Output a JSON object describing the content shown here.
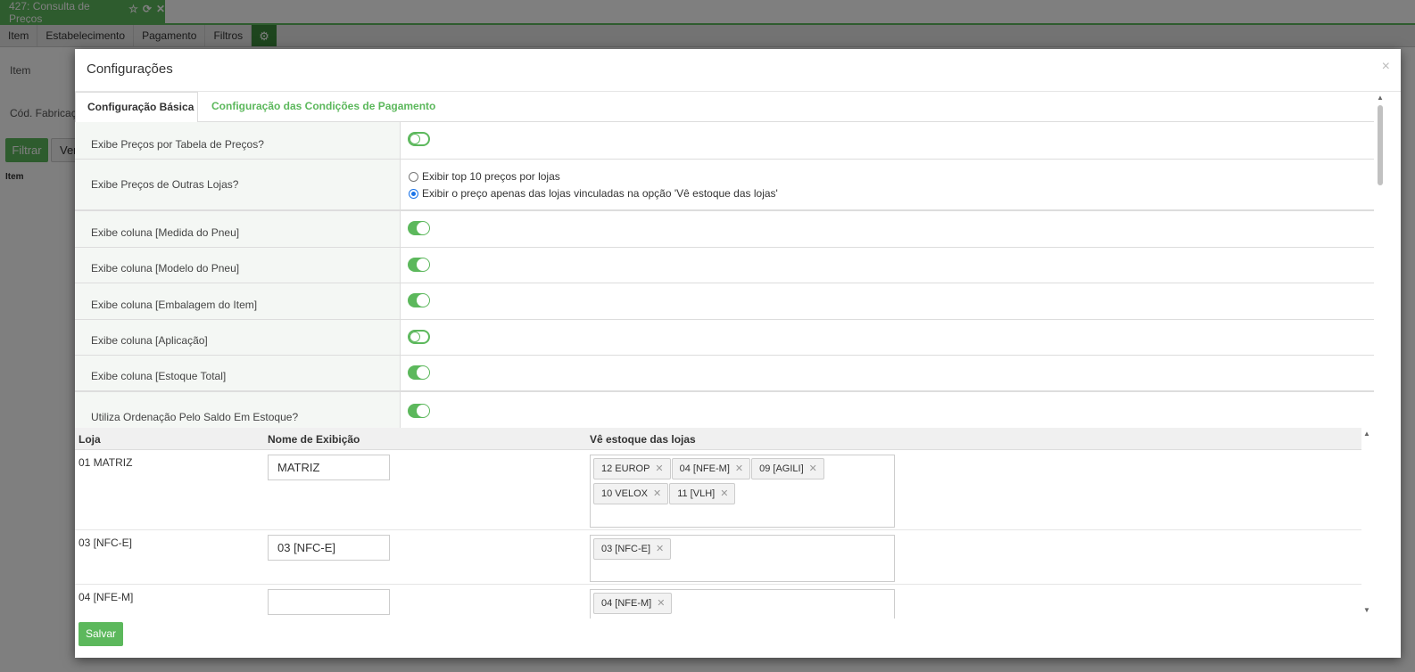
{
  "app": {
    "tab_title": "427: Consulta de Preços",
    "tab_icons": [
      "star-icon",
      "refresh-icon",
      "close-icon"
    ],
    "menu": [
      "Item",
      "Estabelecimento",
      "Pagamento",
      "Filtros"
    ],
    "menu_gear_icon": "gears-icon",
    "bg_labels": {
      "item": "Item",
      "cod_fabricacao": "Cód. Fabricaçã",
      "col_item": "Item"
    },
    "bg_buttons": {
      "filtrar": "Filtrar",
      "ver": "Ver"
    },
    "accent_color": "#5cb85c"
  },
  "modal": {
    "title": "Configurações",
    "close_glyph": "×",
    "tabs": [
      {
        "label": "Configuração Básica",
        "active": true
      },
      {
        "label": "Configuração das Condições de Pagamento",
        "active": false
      }
    ],
    "settings": [
      {
        "label": "Exibe Preços por Tabela de Preços?",
        "type": "toggle",
        "on": false
      },
      {
        "label": "Exibe Preços de Outras Lojas?",
        "type": "radio",
        "options": [
          {
            "label": "Exibir top 10 preços por lojas",
            "checked": false
          },
          {
            "label": "Exibir o preço apenas das lojas vinculadas na opção 'Vê estoque das lojas'",
            "checked": true
          }
        ]
      },
      {
        "label": "Exibe coluna [Medida do Pneu]",
        "type": "toggle",
        "on": true
      },
      {
        "label": "Exibe coluna [Modelo do Pneu]",
        "type": "toggle",
        "on": true
      },
      {
        "label": "Exibe coluna [Embalagem do Item]",
        "type": "toggle",
        "on": true
      },
      {
        "label": "Exibe coluna [Aplicação]",
        "type": "toggle",
        "on": false
      },
      {
        "label": "Exibe coluna [Estoque Total]",
        "type": "toggle",
        "on": true
      },
      {
        "label": "Utiliza Ordenação Pelo Saldo Em Estoque?",
        "type": "toggle",
        "on": true
      }
    ],
    "grid": {
      "headers": {
        "loja": "Loja",
        "nome": "Nome de Exibição",
        "estoque": "Vê estoque das lojas"
      },
      "rows": [
        {
          "loja": "01 MATRIZ",
          "nome": "MATRIZ",
          "tags": [
            "12 EUROP",
            "04 [NFE-M]",
            "09 [AGILI]",
            "10 VELOX",
            "11 [VLH]"
          ]
        },
        {
          "loja": "03 [NFC-E]",
          "nome": "03 [NFC-E]",
          "tags": [
            "03 [NFC-E]"
          ]
        },
        {
          "loja": "04 [NFE-M]",
          "nome": "",
          "tags": [
            "04 [NFE-M]"
          ]
        }
      ]
    },
    "save_label": "Salvar"
  }
}
